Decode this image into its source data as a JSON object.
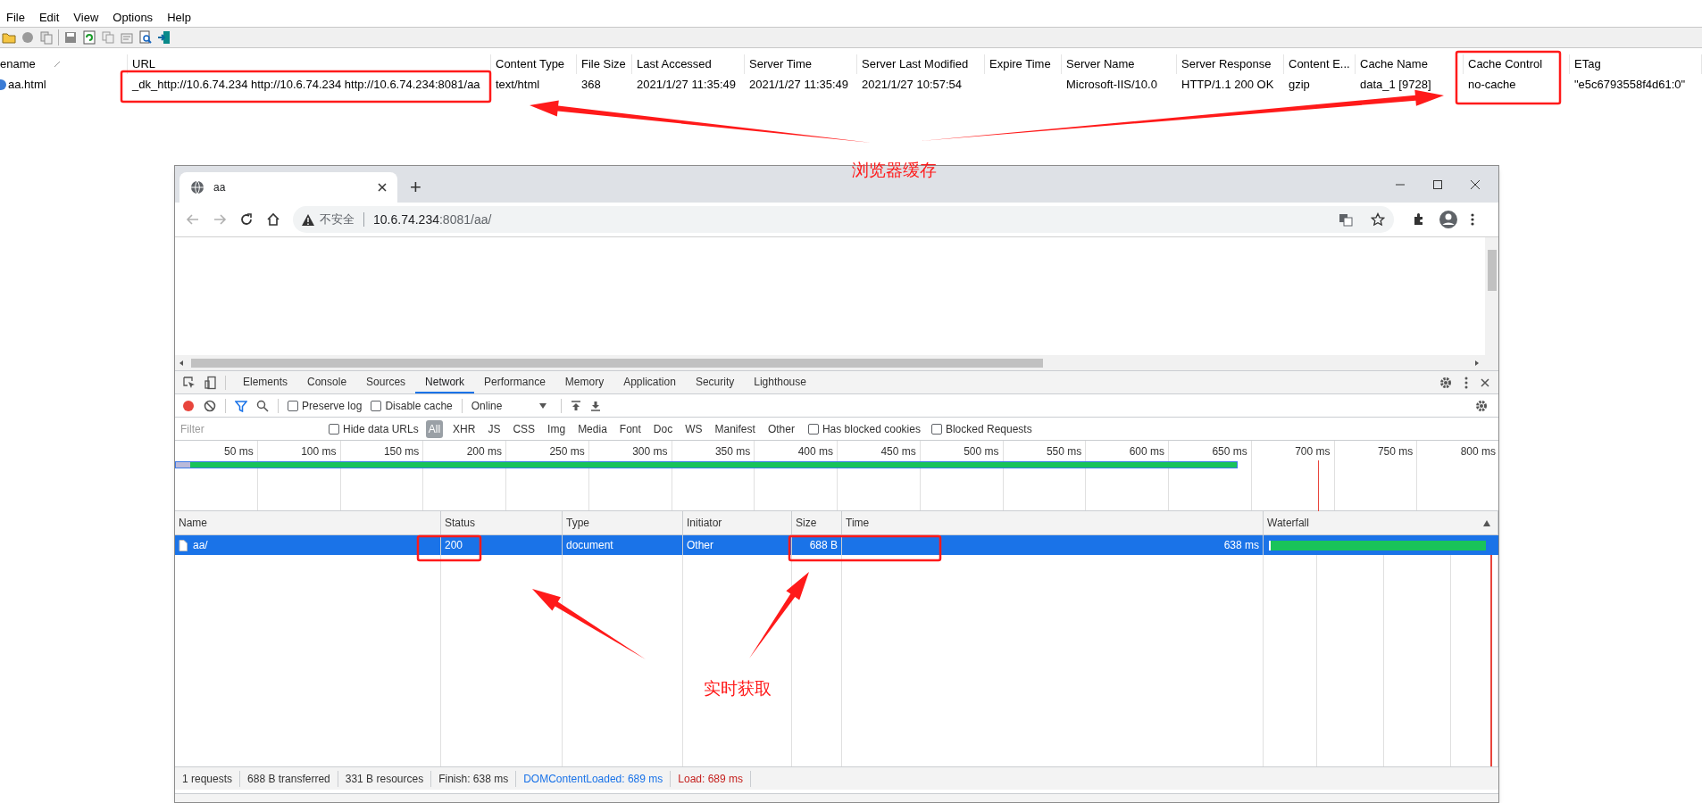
{
  "cache_viewer": {
    "menu": [
      "File",
      "Edit",
      "View",
      "Options",
      "Help"
    ],
    "columns": [
      "ename",
      "URL",
      "Content Type",
      "File Size",
      "Last Accessed",
      "Server Time",
      "Server Last Modified",
      "Expire Time",
      "Server Name",
      "Server Response",
      "Content E...",
      "Cache Name",
      "Cache Control",
      "ETag"
    ],
    "rows": [
      {
        "cells": [
          "aa.html",
          "_dk_http://10.6.74.234 http://10.6.74.234 http://10.6.74.234:8081/aa",
          "text/html",
          "368",
          "2021/1/27 11:35:49",
          "2021/1/27 11:35:49",
          "2021/1/27 10:57:54",
          null,
          "Microsoft-IIS/10.0",
          "HTTP/1.1 200 OK",
          "gzip",
          "data_1  [9728]",
          "no-cache",
          "\"e5c6793558f4d61:0\""
        ]
      }
    ]
  },
  "browser": {
    "tab": {
      "title": "aa",
      "selected": true
    },
    "new_tab": "+",
    "address": {
      "warning": "不安全",
      "host": "10.6.74.234",
      "path": ":8081/aa/"
    }
  },
  "devtools": {
    "tabs": [
      {
        "label": "Elements",
        "selected": false
      },
      {
        "label": "Console",
        "selected": false
      },
      {
        "label": "Sources",
        "selected": false
      },
      {
        "label": "Network",
        "selected": true
      },
      {
        "label": "Performance",
        "selected": false
      },
      {
        "label": "Memory",
        "selected": false
      },
      {
        "label": "Application",
        "selected": false
      },
      {
        "label": "Security",
        "selected": false
      },
      {
        "label": "Lighthouse",
        "selected": false
      }
    ],
    "recording": true,
    "options": [
      {
        "label": "Preserve log",
        "checked": false
      },
      {
        "label": "Disable cache",
        "checked": false
      }
    ],
    "throttling": "Online",
    "filter": {
      "placeholder": "Filter"
    },
    "hide_data_urls": {
      "label": "Hide data URLs",
      "checked": false
    },
    "type_filters": [
      {
        "label": "All",
        "selected": true
      },
      {
        "label": "XHR",
        "selected": false
      },
      {
        "label": "JS",
        "selected": false
      },
      {
        "label": "CSS",
        "selected": false
      },
      {
        "label": "Img",
        "selected": false
      },
      {
        "label": "Media",
        "selected": false
      },
      {
        "label": "Font",
        "selected": false
      },
      {
        "label": "Doc",
        "selected": false
      },
      {
        "label": "WS",
        "selected": false
      },
      {
        "label": "Manifest",
        "selected": false
      },
      {
        "label": "Other",
        "selected": false
      }
    ],
    "blocked_filters": [
      {
        "label": "Has blocked cookies",
        "checked": false
      },
      {
        "label": "Blocked Requests",
        "checked": false
      }
    ],
    "timeline_ticks": [
      "50 ms",
      "100 ms",
      "150 ms",
      "200 ms",
      "250 ms",
      "300 ms",
      "350 ms",
      "400 ms",
      "450 ms",
      "500 ms",
      "550 ms",
      "600 ms",
      "650 ms",
      "700 ms",
      "750 ms",
      "800 ms"
    ],
    "table": {
      "columns": [
        "Name",
        "Status",
        "Type",
        "Initiator",
        "Size",
        "Time",
        "Waterfall"
      ],
      "rows": [
        {
          "name": "aa/",
          "status": "200",
          "type": "document",
          "initiator": "Other",
          "size": "688 B",
          "time": "638 ms",
          "selected": true
        }
      ]
    },
    "status_bar": [
      {
        "text": "1 requests",
        "color": "#333333"
      },
      {
        "text": "688 B transferred",
        "color": "#333333"
      },
      {
        "text": "331 B resources",
        "color": "#333333"
      },
      {
        "text": "Finish: 638 ms",
        "color": "#333333"
      },
      {
        "text": "DOMContentLoaded: 689 ms",
        "color": "#1a73e8"
      },
      {
        "text": "Load: 689 ms",
        "color": "#c5221f"
      }
    ]
  },
  "annotations": {
    "labels": [
      "浏览器缓存",
      "实时获取"
    ]
  }
}
